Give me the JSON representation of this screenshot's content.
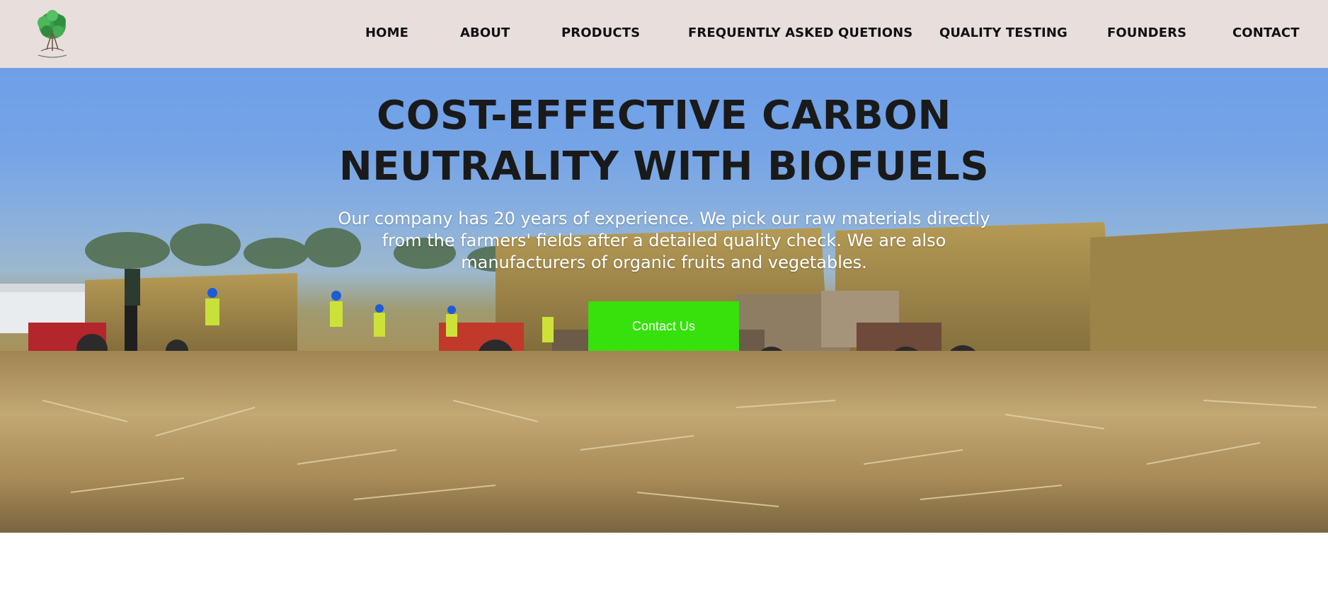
{
  "header": {
    "logo_icon": "tree-logo",
    "nav": [
      {
        "label": "HOME"
      },
      {
        "label": "ABOUT"
      },
      {
        "label": "PRODUCTS"
      },
      {
        "label": "FREQUENTLY ASKED QUETIONS"
      },
      {
        "label": "QUALITY TESTING"
      },
      {
        "label": "FOUNDERS"
      },
      {
        "label": "CONTACT"
      }
    ]
  },
  "hero": {
    "title_line1": "COST-EFFECTIVE CARBON",
    "title_line2": "NEUTRALITY WITH BIOFUELS",
    "description": "Our company has 20 years of experience. We pick our raw materials directly from the farmers' fields after a detailed quality check. We are also manufacturers of organic fruits and vegetables.",
    "cta_label": "Contact Us",
    "background": "straw-field-tractors-photo"
  },
  "colors": {
    "header_bg": "#e8dfdd",
    "cta_bg": "#37e10b",
    "title": "#1a1a1a",
    "sky": "#6e9fe8",
    "straw": "#b59b66"
  }
}
